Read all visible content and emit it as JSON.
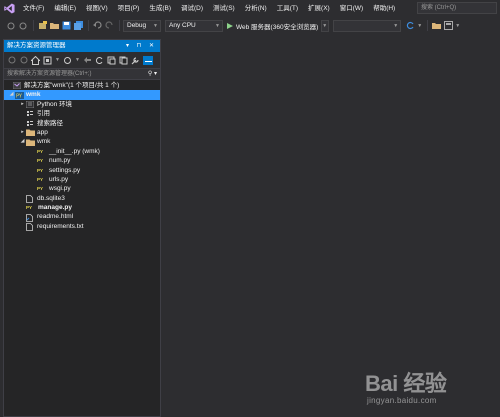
{
  "menu": {
    "items": [
      "文件(F)",
      "编辑(E)",
      "视图(V)",
      "项目(P)",
      "生成(B)",
      "调试(D)",
      "测试(S)",
      "分析(N)",
      "工具(T)",
      "扩展(X)",
      "窗口(W)",
      "帮助(H)"
    ],
    "quick_launch": "搜索 (Ctrl+Q)"
  },
  "toolbar": {
    "config": "Debug",
    "platform": "Any CPU",
    "run_label": "Web 服务器(360安全浏览器)"
  },
  "solution_explorer": {
    "title": "解决方案资源管理器",
    "title_buttons": "▾ ⊓ ✕",
    "search_placeholder": "搜索解决方案资源管理器(Ctrl+;)",
    "solution_label": "解决方案\"wmk\"(1 个项目/共 1 个)",
    "project_label": "wmk",
    "items": [
      {
        "label": "Python 环境",
        "indent": 1,
        "expander": "▸",
        "icon": "python-env"
      },
      {
        "label": "引用",
        "indent": 1,
        "expander": "",
        "icon": "references"
      },
      {
        "label": "搜索路径",
        "indent": 1,
        "expander": "",
        "icon": "search-paths"
      },
      {
        "label": "app",
        "indent": 1,
        "expander": "▸",
        "icon": "folder"
      },
      {
        "label": "wmk",
        "indent": 1,
        "expander": "◢",
        "icon": "folder"
      },
      {
        "label": "__init__.py (wmk)",
        "indent": 2,
        "expander": "",
        "icon": "py"
      },
      {
        "label": "num.py",
        "indent": 2,
        "expander": "",
        "icon": "py"
      },
      {
        "label": "settings.py",
        "indent": 2,
        "expander": "",
        "icon": "py"
      },
      {
        "label": "urls.py",
        "indent": 2,
        "expander": "",
        "icon": "py"
      },
      {
        "label": "wsgi.py",
        "indent": 2,
        "expander": "",
        "icon": "py"
      },
      {
        "label": "db.sqlite3",
        "indent": 1,
        "expander": "",
        "icon": "file"
      },
      {
        "label": "manage.py",
        "indent": 1,
        "expander": "",
        "icon": "py",
        "bold": true
      },
      {
        "label": "readme.html",
        "indent": 1,
        "expander": "",
        "icon": "html"
      },
      {
        "label": "requirements.txt",
        "indent": 1,
        "expander": "",
        "icon": "file"
      }
    ]
  },
  "watermark": {
    "text": "Bai 经验",
    "url": "jingyan.baidu.com"
  },
  "colors": {
    "accent": "#007acc",
    "selection": "#3399ff",
    "background": "#2d2d30",
    "panel": "#252526"
  }
}
